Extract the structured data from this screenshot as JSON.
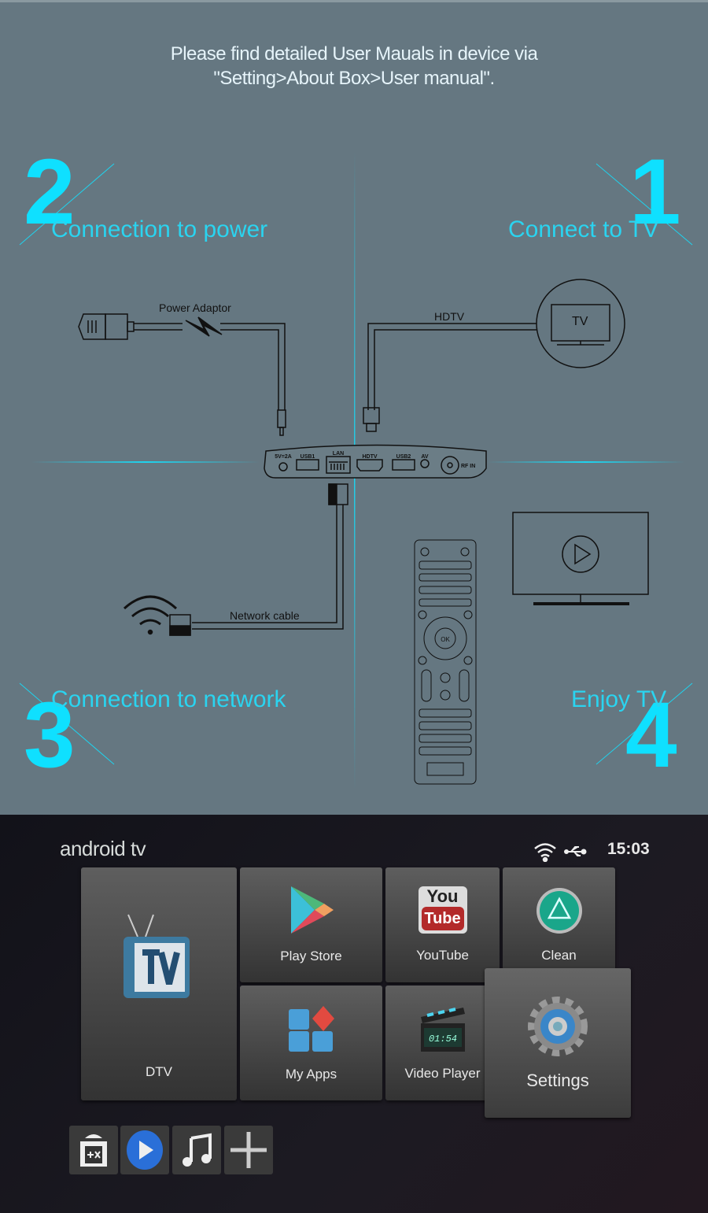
{
  "notice": {
    "line1": "Please find detailed User Mauals in device via",
    "line2": "\"Setting>About Box>User manual\"."
  },
  "steps": [
    {
      "number": "2",
      "label": "Connection to power"
    },
    {
      "number": "1",
      "label": "Connect to TV"
    },
    {
      "number": "3",
      "label": "Connection to network"
    },
    {
      "number": "4",
      "label": "Enjoy TV"
    }
  ],
  "diagram": {
    "power_adaptor": "Power Adaptor",
    "hdtv": "HDTV",
    "tv": "TV",
    "network_cable": "Network cable",
    "ports": [
      "5V=2A",
      "USB1",
      "LAN",
      "HDTV",
      "USB2",
      "AV",
      "RF IN"
    ],
    "remote_ok": "OK"
  },
  "colors": {
    "accent": "#0fe0ff",
    "panel": "#657781"
  },
  "launcher": {
    "brand": "android tv",
    "time": "15:03",
    "status_icons": [
      "wifi-icon",
      "usb-icon"
    ],
    "tiles": [
      {
        "label": "DTV",
        "icon": "tv-icon"
      },
      {
        "label": "Play Store",
        "icon": "play-store-icon"
      },
      {
        "label": "YouTube",
        "icon": "youtube-icon"
      },
      {
        "label": "Clean",
        "icon": "recycle-icon"
      },
      {
        "label": "My Apps",
        "icon": "apps-icon"
      },
      {
        "label": "Video Player",
        "icon": "clapperboard-icon"
      },
      {
        "label": "Settings",
        "icon": "gear-icon"
      }
    ],
    "youtube_you": "You",
    "youtube_tube": "Tube",
    "video_time": "01:54",
    "dock": [
      "android-calc-icon",
      "media-player-icon",
      "music-icon",
      "add-icon"
    ]
  }
}
